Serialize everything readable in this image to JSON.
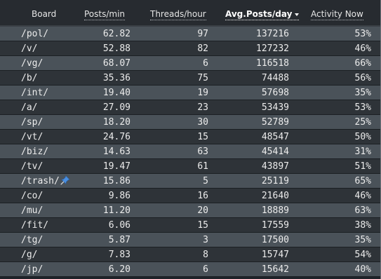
{
  "columns": {
    "board": "Board",
    "posts_per_min": "Posts/min",
    "threads_per_hour": "Threads/hour",
    "avg_posts_per_day": "Avg.Posts/day",
    "activity_now": "Activity Now"
  },
  "sort": {
    "column": "avg_posts_per_day",
    "direction": "descending",
    "icon": "sort-down-icon"
  },
  "rows": [
    {
      "board": "/pol/",
      "posts_per_min": "62.82",
      "threads_per_hour": "97",
      "avg_posts_per_day": "137216",
      "activity_now": "53%"
    },
    {
      "board": "/v/",
      "posts_per_min": "52.88",
      "threads_per_hour": "82",
      "avg_posts_per_day": "127232",
      "activity_now": "46%"
    },
    {
      "board": "/vg/",
      "posts_per_min": "68.07",
      "threads_per_hour": "6",
      "avg_posts_per_day": "116518",
      "activity_now": "66%"
    },
    {
      "board": "/b/",
      "posts_per_min": "35.36",
      "threads_per_hour": "75",
      "avg_posts_per_day": "74488",
      "activity_now": "56%"
    },
    {
      "board": "/int/",
      "posts_per_min": "19.40",
      "threads_per_hour": "19",
      "avg_posts_per_day": "57698",
      "activity_now": "35%"
    },
    {
      "board": "/a/",
      "posts_per_min": "27.09",
      "threads_per_hour": "23",
      "avg_posts_per_day": "53439",
      "activity_now": "53%"
    },
    {
      "board": "/sp/",
      "posts_per_min": "18.20",
      "threads_per_hour": "30",
      "avg_posts_per_day": "52789",
      "activity_now": "25%"
    },
    {
      "board": "/vt/",
      "posts_per_min": "24.76",
      "threads_per_hour": "15",
      "avg_posts_per_day": "48547",
      "activity_now": "50%"
    },
    {
      "board": "/biz/",
      "posts_per_min": "14.63",
      "threads_per_hour": "63",
      "avg_posts_per_day": "45414",
      "activity_now": "31%"
    },
    {
      "board": "/tv/",
      "posts_per_min": "19.47",
      "threads_per_hour": "61",
      "avg_posts_per_day": "43897",
      "activity_now": "51%"
    },
    {
      "board": "/trash/",
      "posts_per_min": "15.86",
      "threads_per_hour": "5",
      "avg_posts_per_day": "25119",
      "activity_now": "65%",
      "icon": "pushpin-icon"
    },
    {
      "board": "/co/",
      "posts_per_min": "9.86",
      "threads_per_hour": "16",
      "avg_posts_per_day": "21640",
      "activity_now": "46%"
    },
    {
      "board": "/mu/",
      "posts_per_min": "11.20",
      "threads_per_hour": "20",
      "avg_posts_per_day": "18889",
      "activity_now": "63%"
    },
    {
      "board": "/fit/",
      "posts_per_min": "6.06",
      "threads_per_hour": "15",
      "avg_posts_per_day": "17559",
      "activity_now": "38%"
    },
    {
      "board": "/tg/",
      "posts_per_min": "5.87",
      "threads_per_hour": "3",
      "avg_posts_per_day": "17500",
      "activity_now": "35%"
    },
    {
      "board": "/g/",
      "posts_per_min": "7.83",
      "threads_per_hour": "8",
      "avg_posts_per_day": "15747",
      "activity_now": "54%"
    },
    {
      "board": "/jp/",
      "posts_per_min": "6.20",
      "threads_per_hour": "6",
      "avg_posts_per_day": "15642",
      "activity_now": "40%"
    }
  ],
  "colors": {
    "header_bg": "#272b30",
    "row_light": "#4a5259",
    "row_dark": "#2e3338",
    "text": "#ececec"
  }
}
